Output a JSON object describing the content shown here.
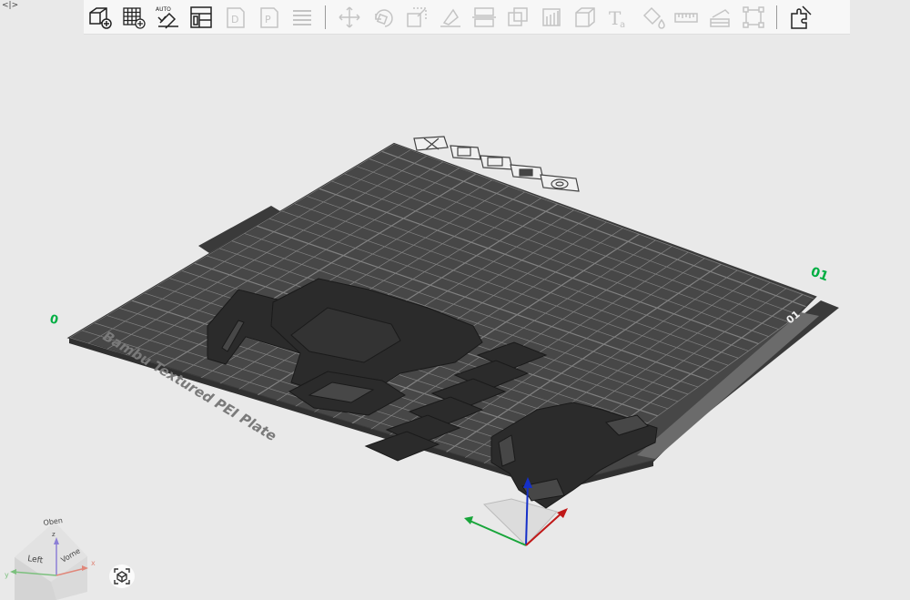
{
  "corner_glyph": "<|>",
  "toolbar": {
    "auto_badge": "AUTO",
    "text_tool_letter": "T"
  },
  "plate": {
    "label": "Bambu Textured PEI Plate",
    "number_left": "0",
    "number_right": "01",
    "side_number": "01"
  },
  "view_cube": {
    "top": "Oben",
    "left": "Left",
    "front": "Vorne",
    "axis_x": "x",
    "axis_y": "y",
    "axis_z": "z"
  },
  "colors": {
    "accent": "#00ae42",
    "plate": "#474747",
    "parts": "#2b2b2b",
    "grid": "#8c8c8c",
    "toolbar_bg": "#f7f7f7",
    "background": "#e9e9e9"
  }
}
